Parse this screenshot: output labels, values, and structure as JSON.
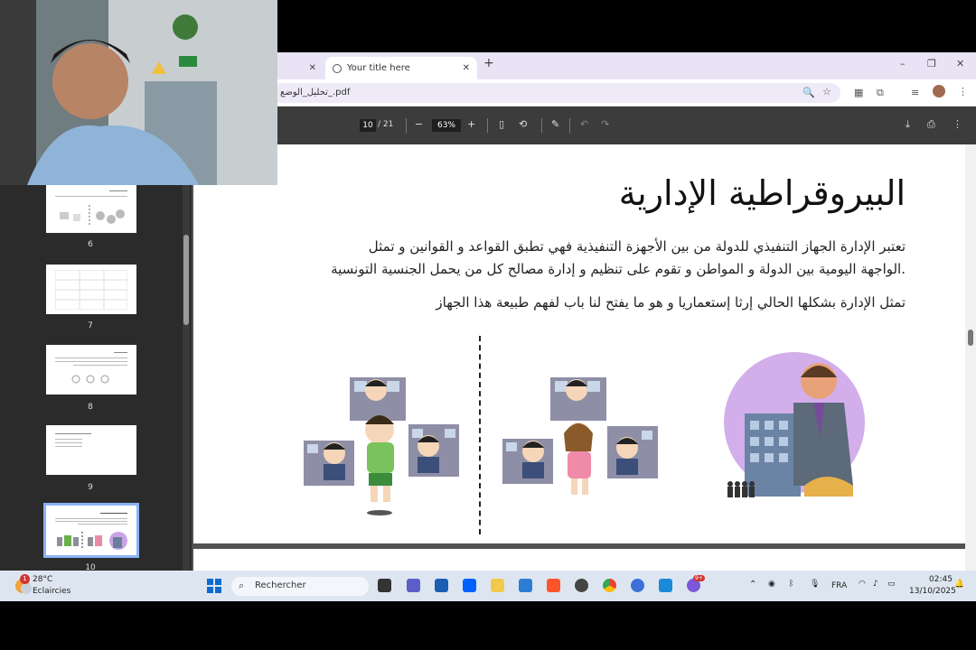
{
  "browser": {
    "tabs": [
      {
        "label": ""
      },
      {
        "label": "Your title here"
      }
    ],
    "url": "تحليل_الوضع_.pdf",
    "window_controls": [
      "–",
      "❐",
      "✕"
    ]
  },
  "pdf_toolbar": {
    "current_page": "10",
    "total_pages": "/ 21",
    "zoom": "63%"
  },
  "thumbnails": [
    {
      "number": "6"
    },
    {
      "number": "7"
    },
    {
      "number": "8"
    },
    {
      "number": "9"
    },
    {
      "number": "10",
      "selected": true
    }
  ],
  "slide": {
    "title": "البيروقراطية الإدارية",
    "paragraph_1_line_1": "تعتبر الإدارة الجهاز التنفيذي للدولة من بين الأجهزة التنفيذية فهي تطبق القواعد و القوانين و تمثل",
    "paragraph_1_line_2": ".الواجهة اليومية بين الدولة و المواطن و تقوم على تنظيم و إدارة مصالح كل من يحمل الجنسية التونسية",
    "paragraph_2": "تمثل الإدارة بشكلها الحالي إرثا إستعماريا و هو ما يفتح لنا باب لفهم طبيعة هذا الجهاز"
  },
  "taskbar": {
    "weather_temp": "28°C",
    "weather_desc": "Eclaircies",
    "weather_badge": "1",
    "search_label": "Rechercher",
    "language": "FRA",
    "time": "02:45",
    "date": "13/10/2025",
    "discord_badge": "9+"
  },
  "colors": {
    "tab_strip": "#e9e4f5",
    "pdf_toolbar": "#3c3c3c",
    "sidebar": "#2b2b2b",
    "selected_thumb": "#8ab4f8",
    "taskbar": "#dde6f0"
  }
}
